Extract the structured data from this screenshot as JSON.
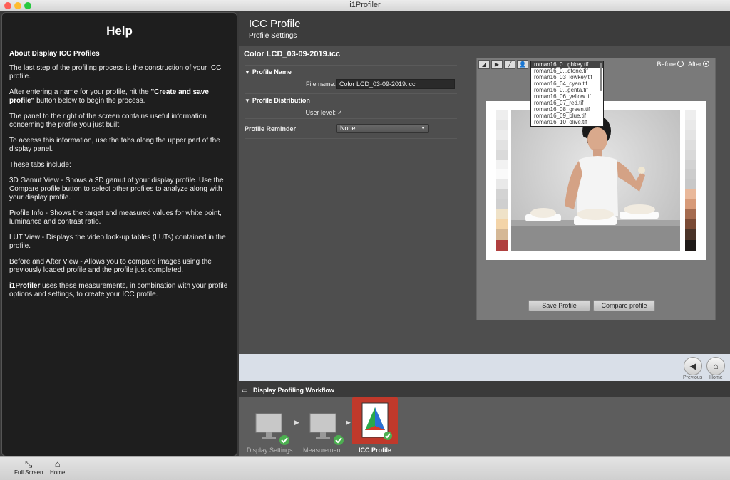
{
  "window": {
    "title": "i1Profiler"
  },
  "help": {
    "title": "Help",
    "section_title": "About Display ICC Profiles",
    "p1": "The last step of the profiling process is the construction of your ICC profile.",
    "p2a": "After entering a name for your profile, hit the ",
    "p2b": "\"Create and save profile\"",
    "p2c": " button below to begin the process.",
    "p3": "The panel to the right of the screen contains useful information concerning the profile you just built.",
    "p4": "To aceess this information, use the tabs along the upper part of the display panel.",
    "p5": "These tabs include:",
    "p6": "3D Gamut View - Shows a 3D gamut of your display profile. Use the Compare profile button to select other profiles to analyze along with your display profile.",
    "p7": "Profile Info - Shows the target and measured values for white point, luminance and contrast ratio.",
    "p8": "LUT View - Displays the video look-up tables (LUTs) contained in the profile.",
    "p9": "Before and After View - Allows you to compare images using the previously loaded profile and the profile just completed.",
    "p10a": "i1Profiler",
    "p10b": " uses these measurements, in combination with your profile options and settings, to create your ICC profile."
  },
  "header": {
    "title": "ICC Profile",
    "subtitle": "Profile Settings"
  },
  "profile": {
    "filename_title": "Color LCD_03-09-2019.icc",
    "section_name": "Profile Name",
    "file_name_label": "File name:",
    "file_name_value": "Color LCD_03-09-2019.icc",
    "section_distribution": "Profile Distribution",
    "user_level_label": "User level:",
    "user_level_checked": "✓",
    "reminder_label": "Profile Reminder",
    "reminder_value": "None"
  },
  "viewer": {
    "before_label": "Before",
    "after_label": "After",
    "selected": "after",
    "images": [
      "roman16_0...ghkey.tif",
      "roman16_0...dtone.tif",
      "roman16_03_lowkey.tif",
      "roman16_04_cyan.tif",
      "roman16_0...genta.tif",
      "roman16_06_yellow.tif",
      "roman16_07_red.tif",
      "roman16_08_green.tif",
      "roman16_09_blue.tif",
      "roman16_10_olive.tif"
    ],
    "save_button": "Save Profile",
    "compare_button": "Compare profile"
  },
  "nav": {
    "previous": "Previous",
    "home": "Home"
  },
  "workflow": {
    "title": "Display Profiling Workflow",
    "steps": [
      "Display Settings",
      "Measurement",
      "ICC Profile"
    ],
    "active_step": "ICC Profile"
  },
  "bottom": {
    "fullscreen": "Full Screen",
    "home": "Home"
  },
  "colors": {
    "accent": "#c0392b",
    "check": "#4caf50",
    "panel": "#1e1e1e"
  }
}
